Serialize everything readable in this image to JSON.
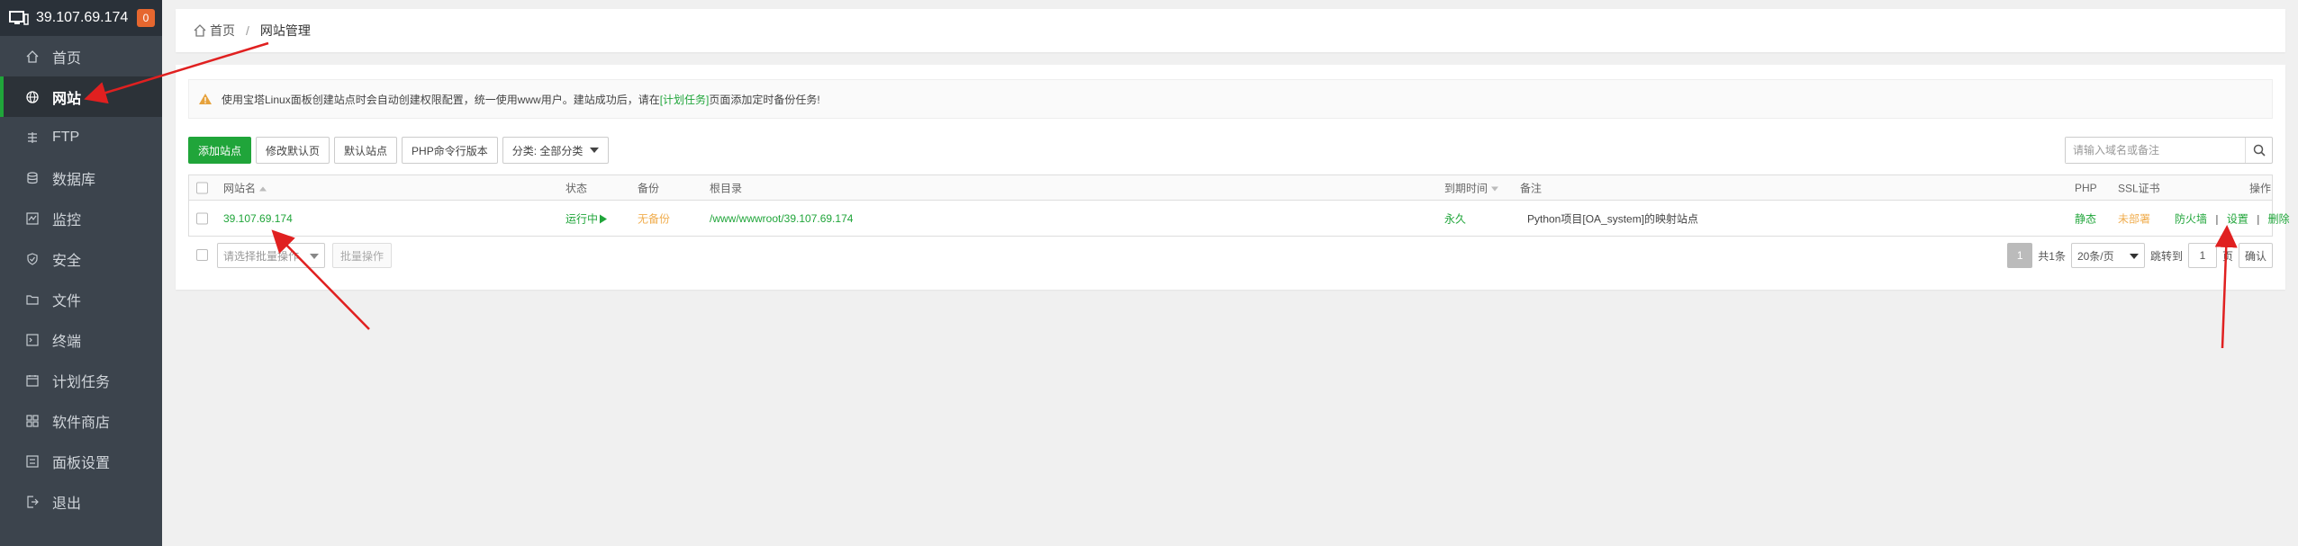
{
  "sidebar": {
    "server_ip": "39.107.69.174",
    "badge": "0",
    "items": [
      {
        "label": "首页",
        "icon": "home-icon"
      },
      {
        "label": "网站",
        "icon": "globe-icon",
        "active": true
      },
      {
        "label": "FTP",
        "icon": "ftp-icon"
      },
      {
        "label": "数据库",
        "icon": "database-icon"
      },
      {
        "label": "监控",
        "icon": "monitor-icon"
      },
      {
        "label": "安全",
        "icon": "shield-icon"
      },
      {
        "label": "文件",
        "icon": "folder-icon"
      },
      {
        "label": "终端",
        "icon": "terminal-icon"
      },
      {
        "label": "计划任务",
        "icon": "calendar-icon"
      },
      {
        "label": "软件商店",
        "icon": "grid-icon"
      },
      {
        "label": "面板设置",
        "icon": "settings-icon"
      },
      {
        "label": "退出",
        "icon": "logout-icon"
      }
    ]
  },
  "breadcrumb": {
    "home": "首页",
    "separator": "/",
    "current": "网站管理"
  },
  "notice": {
    "text_before": "使用宝塔Linux面板创建站点时会自动创建权限配置，统一使用www用户。建站成功后，请在",
    "link": "[计划任务]",
    "text_after": "页面添加定时备份任务!"
  },
  "toolbar": {
    "add_site": "添加站点",
    "modify_default_page": "修改默认页",
    "default_site": "默认站点",
    "php_cli_version": "PHP命令行版本",
    "category": "分类: 全部分类"
  },
  "search": {
    "placeholder": "请输入域名或备注"
  },
  "table": {
    "headers": {
      "name": "网站名",
      "status": "状态",
      "backup": "备份",
      "root": "根目录",
      "expire": "到期时间",
      "remark": "备注",
      "php": "PHP",
      "ssl": "SSL证书",
      "actions": "操作"
    },
    "rows": [
      {
        "name": "39.107.69.174",
        "status": "运行中",
        "backup": "无备份",
        "root": "/www/wwwroot/39.107.69.174",
        "expire": "永久",
        "remark": "Python项目[OA_system]的映射站点",
        "php": "静态",
        "ssl": "未部署",
        "action_firewall": "防火墙",
        "action_settings": "设置",
        "action_delete": "删除",
        "separator": "|"
      }
    ]
  },
  "footer": {
    "batch_placeholder": "请选择批量操作",
    "batch_button": "批量操作",
    "current_page": "1",
    "total": "共1条",
    "per_page": "20条/页",
    "jump_label": "跳转到",
    "jump_value": "1",
    "page_suffix": "页",
    "confirm": "确认"
  },
  "colors": {
    "accent": "#20a53a",
    "warning": "#f0ad4e",
    "sidebar_bg": "#3c444d",
    "annotation_arrow": "#e02020"
  }
}
